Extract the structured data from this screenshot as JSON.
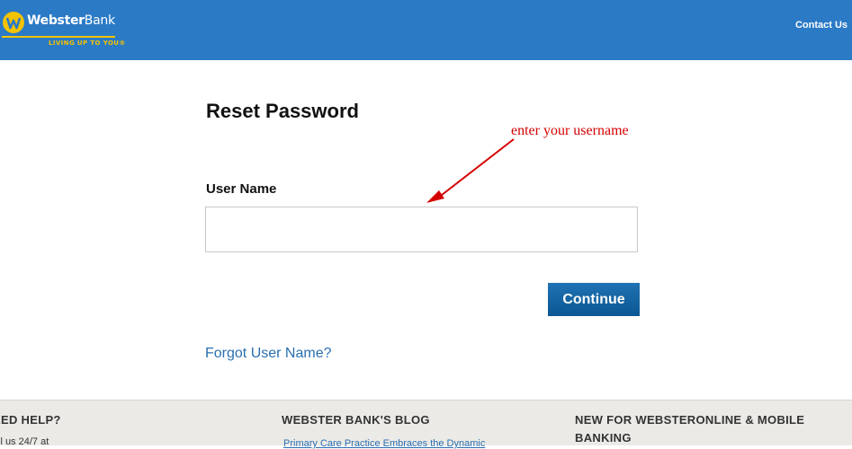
{
  "header": {
    "logo": {
      "name_bold": "Webster",
      "name_light": "Bank",
      "tagline": "LIVING UP TO YOU®"
    },
    "contact_link": "Contact Us"
  },
  "form": {
    "title": "Reset Password",
    "username_label": "User Name",
    "username_value": "",
    "continue_label": "Continue",
    "forgot_link": "Forgot User Name?"
  },
  "annotation": {
    "text": "enter your username",
    "color": "#d40000"
  },
  "footer": {
    "help_heading": "EED HELP?",
    "help_text": "ll us 24/7 at",
    "blog_heading": "WEBSTER BANK'S BLOG",
    "blog_link": "Primary Care Practice Embraces the Dynamic",
    "new_heading": "NEW FOR WEBSTERONLINE & MOBILE BANKING"
  },
  "colors": {
    "header_bg": "#2b7ac6",
    "accent_yellow": "#f4c300",
    "button": "#0c5793",
    "link": "#2a6fb0"
  }
}
